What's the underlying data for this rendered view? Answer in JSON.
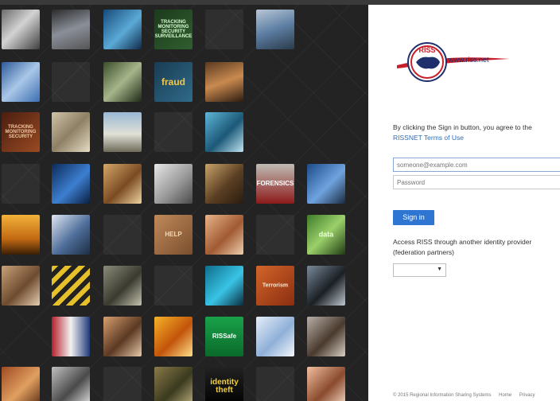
{
  "mosaic": {
    "tiles": [
      {
        "name": "tile-network-cables",
        "row": 0,
        "col": 0,
        "bg": "linear-gradient(135deg,#6b6b6b,#d3d3d3 45%,#3f3f3f)"
      },
      {
        "name": "tile-security-officers",
        "row": 0,
        "col": 1,
        "bg": "linear-gradient(160deg,#2b2b2b,#8a8f99 50%,#555)"
      },
      {
        "name": "tile-computer-screens",
        "row": 0,
        "col": 2,
        "bg": "linear-gradient(135deg,#164a7a,#5aa9d6 55%,#0f2b4a)"
      },
      {
        "name": "tile-tracking-monitoring",
        "row": 0,
        "col": 3,
        "bg": "linear-gradient(135deg,#1d3a1d,#2f5f2f)",
        "label": "TRACKING MONITORING SECURITY SURVEILLANCE",
        "color": "#d8ffd0",
        "size": "6px"
      },
      {
        "name": "tile-empty-0-4",
        "row": 0,
        "col": 4,
        "empty": true
      },
      {
        "name": "tile-analyst-workstation",
        "row": 0,
        "col": 5,
        "bg": "linear-gradient(160deg,#b9c7d6,#5d7ea3 50%,#2a3a4a)"
      },
      {
        "name": "tile-map-overlay",
        "row": 1,
        "col": 0,
        "bg": "linear-gradient(135deg,#2e5b9a,#a9c7e8 50%,#3c6eb0)"
      },
      {
        "name": "tile-empty-1-1",
        "row": 1,
        "col": 1,
        "empty": true
      },
      {
        "name": "tile-circuit-board",
        "row": 1,
        "col": 2,
        "bg": "linear-gradient(135deg,#3a4d2a,#a7b58b 50%,#1f2a16)"
      },
      {
        "name": "tile-fraud-text",
        "row": 1,
        "col": 3,
        "bg": "linear-gradient(135deg,#1a3b52,#2f6b8a)",
        "label": "fraud",
        "color": "#f3c84b",
        "size": "12px"
      },
      {
        "name": "tile-briefing-room",
        "row": 1,
        "col": 4,
        "bg": "linear-gradient(160deg,#5a3a22,#c98a4f 50%,#2d1c10)"
      },
      {
        "name": "tile-tracking-security",
        "row": 2,
        "col": 0,
        "bg": "linear-gradient(135deg,#4a1e10,#9a4a22)",
        "label": "TRACKING MONITORING SECURITY",
        "color": "#f0c9a0",
        "size": "6px"
      },
      {
        "name": "tile-paperwork",
        "row": 2,
        "col": 1,
        "bg": "linear-gradient(135deg,#cfc4a8,#8f8064 50%,#e6ddc6)"
      },
      {
        "name": "tile-vehicles",
        "row": 2,
        "col": 2,
        "bg": "linear-gradient(180deg,#9ab8d4,#e0e0d6 55%,#6f6b5a)"
      },
      {
        "name": "tile-empty-2-3",
        "row": 2,
        "col": 3,
        "empty": true
      },
      {
        "name": "tile-camera-eye",
        "row": 2,
        "col": 4,
        "bg": "linear-gradient(135deg,#5fb6d8,#1c5877 55%,#bfe6f2)"
      },
      {
        "name": "tile-empty-3-0",
        "row": 3,
        "col": 0,
        "empty": true
      },
      {
        "name": "tile-fingerprint",
        "row": 3,
        "col": 1,
        "bg": "linear-gradient(135deg,#0b2a5a,#3d7fd0 55%,#0a1f40)"
      },
      {
        "name": "tile-gavel",
        "row": 3,
        "col": 2,
        "bg": "linear-gradient(135deg,#d4a86a,#7a4b22 55%,#efd3a0)"
      },
      {
        "name": "tile-lab-technician",
        "row": 3,
        "col": 3,
        "bg": "linear-gradient(135deg,#e8e8e8,#9a9a9a 55%,#4a4a4a)"
      },
      {
        "name": "tile-surveillance-cam",
        "row": 3,
        "col": 4,
        "bg": "linear-gradient(135deg,#c7a36a,#5a3e22 55%,#2a1c10)"
      },
      {
        "name": "tile-forensics",
        "row": 3,
        "col": 5,
        "bg": "linear-gradient(180deg,#bfbcb4,#8c1a1a)",
        "label": "FORENSICS",
        "color": "#ffffff",
        "size": "8px"
      },
      {
        "name": "tile-cyber-analyst",
        "row": 3,
        "col": 6,
        "bg": "linear-gradient(135deg,#1c4a8a,#6fa3de 55%,#1a2a40)"
      },
      {
        "name": "tile-soldiers-silhouette",
        "row": 4,
        "col": 0,
        "bg": "linear-gradient(180deg,#f2b13a,#c26a12 60%,#3a1e05)"
      },
      {
        "name": "tile-officers-conference",
        "row": 4,
        "col": 1,
        "bg": "linear-gradient(135deg,#dfe7f2,#4d6d99 55%,#1e2e44)"
      },
      {
        "name": "tile-empty-4-2",
        "row": 4,
        "col": 2,
        "empty": true
      },
      {
        "name": "tile-empty-4-3b",
        "row": 4,
        "col": 3,
        "bg": "linear-gradient(135deg,#c0895a,#7a4f2e)",
        "label": "HELP",
        "color": "#f6d7b5",
        "size": "8px"
      },
      {
        "name": "tile-handshake",
        "row": 4,
        "col": 4,
        "bg": "linear-gradient(135deg,#e8b48a,#a05a32 55%,#f0cfae)"
      },
      {
        "name": "tile-empty-4-5",
        "row": 4,
        "col": 5,
        "empty": true
      },
      {
        "name": "tile-data-globe",
        "row": 4,
        "col": 6,
        "bg": "linear-gradient(135deg,#3e7a2a,#9bd06a 50%,#1e3a12)",
        "label": "data",
        "color": "#eaffd8",
        "size": "9px"
      },
      {
        "name": "tile-classroom",
        "row": 5,
        "col": 0,
        "bg": "linear-gradient(135deg,#c9a27a,#6d4b2e 55%,#e5cdb0)"
      },
      {
        "name": "tile-hazard-tape",
        "row": 5,
        "col": 1,
        "bg": "repeating-linear-gradient(135deg,#e7c12a 0 6px,#222 6px 12px)"
      },
      {
        "name": "tile-hardware-desk",
        "row": 5,
        "col": 2,
        "bg": "linear-gradient(135deg,#8c8c7a,#3a3a30 55%,#c4c2ae)"
      },
      {
        "name": "tile-empty-5-3",
        "row": 5,
        "col": 3,
        "empty": true
      },
      {
        "name": "tile-padlock",
        "row": 5,
        "col": 4,
        "bg": "linear-gradient(135deg,#0f6d8a,#39c4e6 55%,#0a2d40)"
      },
      {
        "name": "tile-terrorism-text",
        "row": 5,
        "col": 5,
        "bg": "linear-gradient(135deg,#d2652a,#8a2d10)",
        "label": "Terrorism",
        "color": "#ffe9d0",
        "size": "7px"
      },
      {
        "name": "tile-camera-lens",
        "row": 5,
        "col": 6,
        "bg": "linear-gradient(135deg,#7a8a9a,#1a1f24 55%,#c0c8d0)"
      },
      {
        "name": "tile-flag-ceremony",
        "row": 6,
        "col": 1,
        "bg": "linear-gradient(90deg,#b7202a,#f2f2f2 50%,#1f3a7a)"
      },
      {
        "name": "tile-seminar",
        "row": 6,
        "col": 2,
        "bg": "linear-gradient(135deg,#d8a070,#5a3822 55%,#e8caa8)"
      },
      {
        "name": "tile-orange-lights",
        "row": 6,
        "col": 3,
        "bg": "linear-gradient(135deg,#f6b32a,#c2540a 55%,#ffe08a)"
      },
      {
        "name": "tile-rissafe-badge",
        "row": 6,
        "col": 4,
        "bg": "linear-gradient(180deg,#1aa24a,#0a6a2a)",
        "label": "RISSafe",
        "color": "#ffffff",
        "size": "8px"
      },
      {
        "name": "tile-locations-map",
        "row": 6,
        "col": 5,
        "bg": "linear-gradient(135deg,#e6eef8,#8fb0d8 55%,#f5f8fc)"
      },
      {
        "name": "tile-crowd",
        "row": 6,
        "col": 6,
        "bg": "linear-gradient(135deg,#b8b0a8,#4a3a2e 55%,#d8d0c4)"
      },
      {
        "name": "tile-workers",
        "row": 7,
        "col": 0,
        "bg": "linear-gradient(135deg,#a04a22,#e0a060 55%,#5a2a12)"
      },
      {
        "name": "tile-handcuffs",
        "row": 7,
        "col": 1,
        "bg": "linear-gradient(135deg,#c0c0c0,#4a4a4a 55%,#e6e6e6)"
      },
      {
        "name": "tile-empty-7-2",
        "row": 7,
        "col": 2,
        "empty": true
      },
      {
        "name": "tile-soldiers-field",
        "row": 7,
        "col": 3,
        "bg": "linear-gradient(135deg,#8a7a4a,#3a3a1e 55%,#c0b080)"
      },
      {
        "name": "tile-identity-theft",
        "row": 7,
        "col": 4,
        "bg": "linear-gradient(180deg,#222,#000)",
        "label": "identity theft",
        "color": "#f3d03a",
        "size": "10px"
      },
      {
        "name": "tile-empty-7-5",
        "row": 7,
        "col": 5,
        "empty": true
      },
      {
        "name": "tile-headset-operator",
        "row": 7,
        "col": 6,
        "bg": "linear-gradient(135deg,#f2c0a0,#8a4a2e 55%,#f8dcc8)"
      }
    ]
  },
  "login": {
    "logo_text": "RISS",
    "logo_url": "www.riss.net",
    "agree_text": "By clicking the Sign in button, you agree to the",
    "terms_link": "RISSNET Terms of Use",
    "email_placeholder": "someone@example.com",
    "password_placeholder": "Password",
    "signin_label": "Sign in",
    "access_text": "Access RISS through another identity provider (federation partners)",
    "select_value": "",
    "select_arrow": "▼"
  },
  "footer": {
    "copyright": "© 2015 Regional Information Sharing Systems",
    "home": "Home",
    "privacy": "Privacy"
  },
  "colors": {
    "accent": "#2f76d2",
    "link": "#2e6db5",
    "logo_red": "#c8202a",
    "logo_navy": "#1f2f6b"
  }
}
